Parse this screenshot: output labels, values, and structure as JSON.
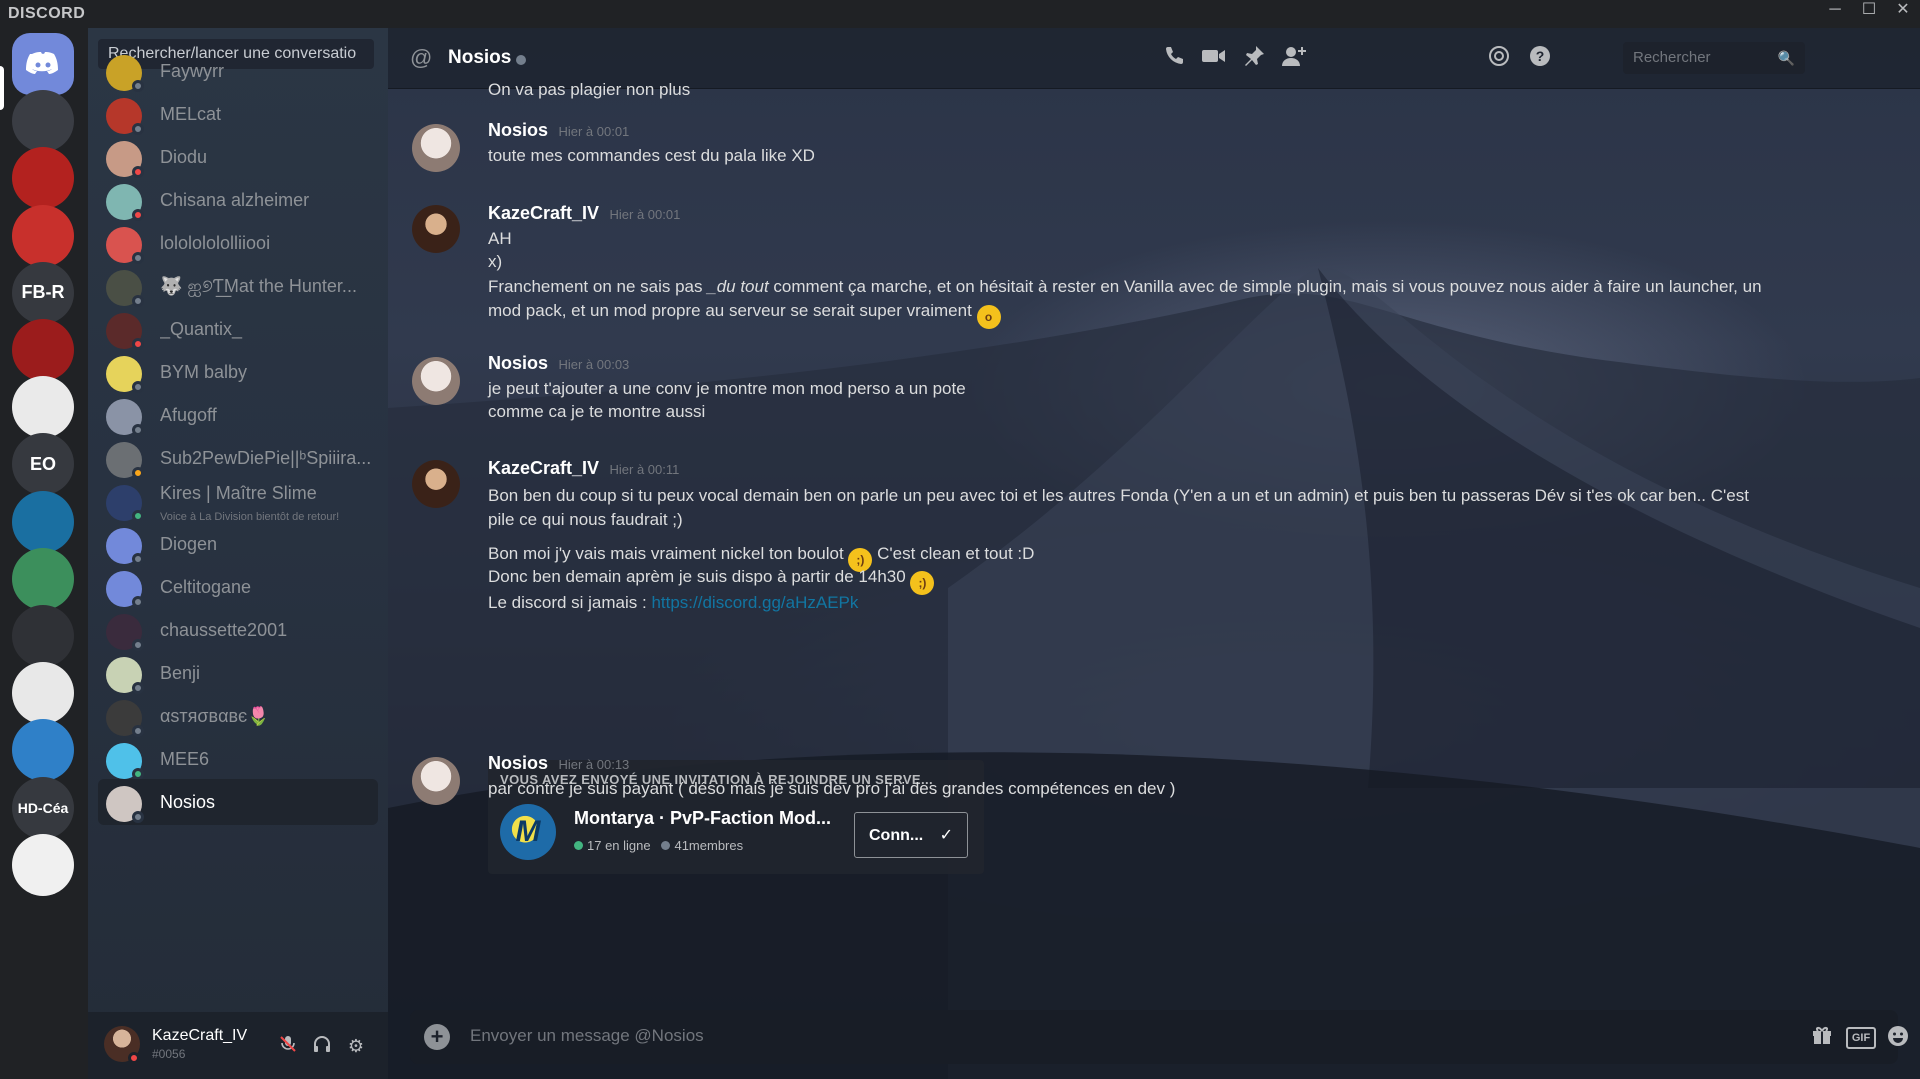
{
  "app": {
    "brand": "DISCORD"
  },
  "servers": [
    {
      "name": "home",
      "label": "",
      "color": "#7289da",
      "home": true
    },
    {
      "name": "server-ds",
      "label": "",
      "color": "#3a3d44"
    },
    {
      "name": "server-wos",
      "label": "",
      "color": "#b3221f"
    },
    {
      "name": "server-red",
      "label": "",
      "color": "#c8302c"
    },
    {
      "name": "server-fb-r",
      "label": "FB-R",
      "color": "#36393f"
    },
    {
      "name": "server-n",
      "label": "",
      "color": "#9b1c1c"
    },
    {
      "name": "server-tenth-section",
      "label": "",
      "color": "#eaeaea"
    },
    {
      "name": "server-eo",
      "label": "EO",
      "color": "#36393f"
    },
    {
      "name": "server-vrchat",
      "label": "",
      "color": "#1a6fa1"
    },
    {
      "name": "server-fcm",
      "label": "",
      "color": "#3c8f5c"
    },
    {
      "name": "server-worker",
      "label": "",
      "color": "#2f3136"
    },
    {
      "name": "server-pa",
      "label": "",
      "color": "#e8e8e8"
    },
    {
      "name": "server-vaultboy",
      "label": "",
      "color": "#2f80c8"
    },
    {
      "name": "server-hd-cea",
      "label": "HD-Céa",
      "color": "#36393f"
    },
    {
      "name": "server-ariane",
      "label": "",
      "color": "#f0f0f0"
    }
  ],
  "dm": {
    "search_placeholder": "Rechercher/lancer une conversatio",
    "items": [
      {
        "name": "Faywyrr",
        "avatar": "#c9a227",
        "status": "#747f8d"
      },
      {
        "name": "MELcat",
        "avatar": "#b6372a",
        "status": "#747f8d"
      },
      {
        "name": "Diodu",
        "avatar": "#c79a86",
        "status": "#f04747"
      },
      {
        "name": "Chisana alzheimer",
        "avatar": "#7fb6b1",
        "status": "#f04747"
      },
      {
        "name": "lolololololliiooi",
        "avatar": "#d9534f",
        "status": "#747f8d"
      },
      {
        "name": "🐺 ஐ୭Ƭ͟Mat the Hunter...",
        "avatar": "#4a4f45",
        "status": "#747f8d"
      },
      {
        "name": "_Quantix_",
        "avatar": "#5b2a2a",
        "status": "#f04747"
      },
      {
        "name": "BYM balby",
        "avatar": "#e6d35b",
        "status": "#747f8d"
      },
      {
        "name": "Afugoff",
        "avatar": "#8a93a6",
        "status": "#747f8d"
      },
      {
        "name": "Sub2PewDiePie||ᵇSpiiira...",
        "avatar": "#6b6f73",
        "status": "#faa61a"
      },
      {
        "name": "Kires | Maître Slime",
        "sub": "Voice à La Division bientôt de retour!",
        "avatar": "#2d3f6b",
        "status": "#43b581"
      },
      {
        "name": "Diogen",
        "avatar": "#7289da",
        "status": "#747f8d"
      },
      {
        "name": "Celtitogane",
        "avatar": "#7289da",
        "status": "#747f8d"
      },
      {
        "name": "chaussette2001",
        "avatar": "#3a2b3d",
        "status": "#747f8d"
      },
      {
        "name": "Benji",
        "avatar": "#c8d2b4",
        "status": "#747f8d"
      },
      {
        "name": "αѕтяσвαвє🌷",
        "avatar": "#3b3b3b",
        "status": "#747f8d"
      },
      {
        "name": "MEE6",
        "avatar": "#4fc1e9",
        "status": "#43b581"
      },
      {
        "name": "Nosios",
        "avatar": "#cfc6c2",
        "status": "#747f8d",
        "active": true
      }
    ]
  },
  "user": {
    "name": "KazeCraft_IV",
    "tag": "#0056"
  },
  "header": {
    "channel": "Nosios",
    "search_placeholder": "Rechercher"
  },
  "messages": {
    "top_line": "On va pas plagier non plus",
    "m1": {
      "author": "Nosios",
      "time": "Hier à 00:01",
      "lines": [
        "toute mes commandes cest du pala like XD"
      ]
    },
    "m2": {
      "author": "KazeCraft_IV",
      "time": "Hier à 00:01",
      "l1": "AH",
      "l2": "x)",
      "p_a": "Franchement on ne sais pas ",
      "p_em": "_du tout",
      "p_b": " comment ça marche, et on hésitait à rester en Vanilla avec de simple plugin, mais si vous pouvez nous aider à faire un launcher, un mod pack, et un mod propre au serveur se serait super vraiment"
    },
    "m3": {
      "author": "Nosios",
      "time": "Hier à 00:03",
      "l1": "je peut t'ajouter a une conv je montre mon mod perso a un pote",
      "l2": "comme ca je te montre aussi"
    },
    "m4": {
      "author": "KazeCraft_IV",
      "time": "Hier à 00:11",
      "p1": "Bon ben du coup si tu peux vocal demain ben on parle un peu avec toi et les autres Fonda (Y'en a un et un admin) et puis ben tu passeras Dév si t'es ok car ben.. C'est pile ce qui nous faudrait ;)",
      "l2a": "Bon moi j'y vais mais vraiment nickel ton boulot",
      "l2b": "C'est clean et tout :D",
      "l3": "Donc ben demain aprèm je suis dispo à partir de 14h30",
      "l4a": "Le discord si jamais : ",
      "l4link": "https://discord.gg/aHzAEPk",
      "invite": {
        "title": "VOUS AVEZ ENVOYÉ UNE INVITATION À REJOINDRE UN SERVE...",
        "server": "Montarya · PvP-Faction Mod...",
        "online": "17 en ligne",
        "members": "41membres",
        "button": "Conn...",
        "icon_letter": "M"
      }
    },
    "m5": {
      "author": "Nosios",
      "time": "Hier à 00:13",
      "l1": "par contre je suis payant ( déso mais je suis dev pro j'ai des grandes compétences en dev )"
    }
  },
  "composer": {
    "placeholder": "Envoyer un message @Nosios",
    "gif_label": "GIF"
  },
  "colors": {
    "online": "#43b581",
    "offline": "#747f8d",
    "dnd": "#f04747",
    "idle": "#faa61a",
    "blurple": "#7289da"
  }
}
